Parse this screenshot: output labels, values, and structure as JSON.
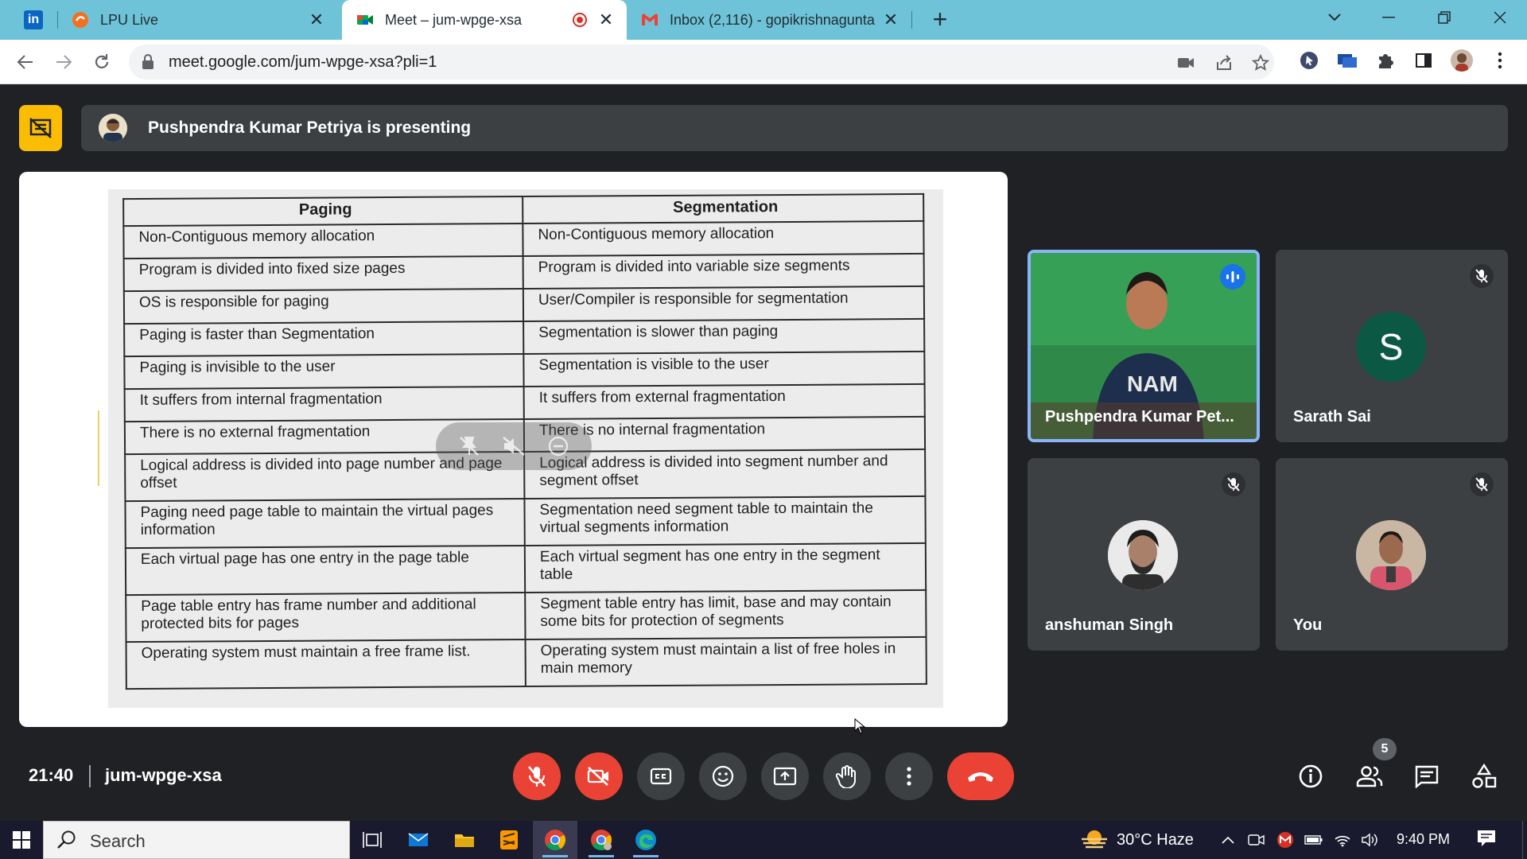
{
  "browser": {
    "tabs": [
      {
        "title": "LPU Live",
        "icon": "lpu-live-icon",
        "active": false
      },
      {
        "title": "Meet – jum-wpge-xsa",
        "icon": "google-meet-icon",
        "active": true,
        "recording": true
      },
      {
        "title": "Inbox (2,116) - gopikrishnagunta",
        "icon": "gmail-icon",
        "active": false
      }
    ],
    "url": "meet.google.com/jum-wpge-xsa?pli=1"
  },
  "meet": {
    "presenting_text": "Pushpendra Kumar Petriya is presenting",
    "slide_table": {
      "headers": [
        "Paging",
        "Segmentation"
      ],
      "rows": [
        [
          "Non-Contiguous memory allocation",
          "Non-Contiguous memory allocation"
        ],
        [
          "Program is divided into fixed size pages",
          "Program is divided into variable size segments"
        ],
        [
          "OS is responsible for paging",
          "User/Compiler is responsible for segmentation"
        ],
        [
          "Paging is faster than Segmentation",
          "Segmentation is slower than paging"
        ],
        [
          "Paging is invisible to the user",
          "Segmentation is visible to the user"
        ],
        [
          "It suffers from internal fragmentation",
          "It suffers from external fragmentation"
        ],
        [
          "There is no external fragmentation",
          "There is no internal fragmentation"
        ],
        [
          "Logical address is divided into page number and page offset",
          "Logical address is divided into segment number and segment offset"
        ],
        [
          "Paging need page table to maintain the virtual pages information",
          "Segmentation need segment table to maintain the virtual segments information"
        ],
        [
          "Each virtual page has one entry in the page table",
          "Each virtual segment has one entry in the segment table"
        ],
        [
          "Page table entry has frame number and additional protected bits for pages",
          "Segment table entry has limit, base and may contain some bits for protection of segments"
        ],
        [
          "Operating system must maintain a free frame list.",
          "Operating system must maintain a list of free holes in main memory"
        ]
      ]
    },
    "participants": [
      {
        "name": "Pushpendra Kumar Pet...",
        "speaking": true
      },
      {
        "name": "Sarath Sai",
        "initial": "S",
        "muted": true,
        "avatar_color": "#0b5945"
      },
      {
        "name": "anshuman Singh",
        "muted": true
      },
      {
        "name": "You",
        "muted": true
      }
    ],
    "time": "21:40",
    "meeting_code": "jum-wpge-xsa",
    "people_count": "5"
  },
  "taskbar": {
    "search_placeholder": "Search",
    "weather": "30°C  Haze",
    "time": "9:40 PM"
  },
  "colors": {
    "tab_strip": "#6fc3d8",
    "meet_bg": "#202124",
    "tile_bg": "#3c4043",
    "danger": "#ea4335",
    "accent": "#1a73e8",
    "present_icon": "#fbbc04"
  }
}
